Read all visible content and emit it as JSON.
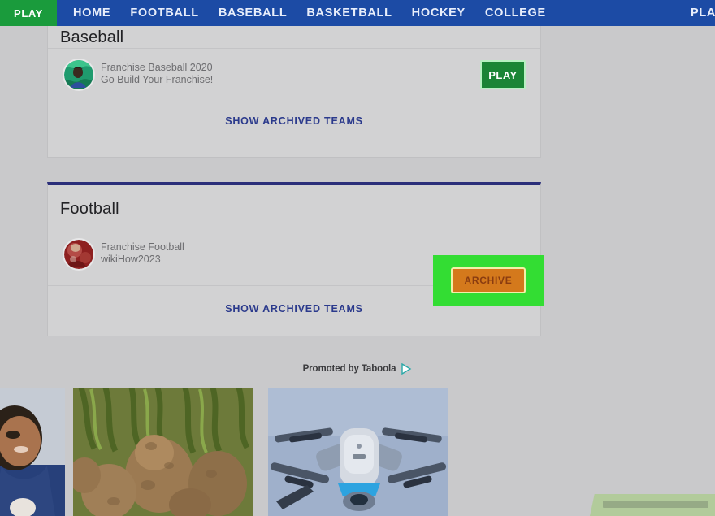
{
  "nav": {
    "play_tab_label": "PLAY",
    "links": [
      {
        "label": "HOME"
      },
      {
        "label": "FOOTBALL"
      },
      {
        "label": "BASEBALL"
      },
      {
        "label": "BASKETBALL"
      },
      {
        "label": "HOCKEY"
      },
      {
        "label": "COLLEGE"
      }
    ],
    "right_partial_label": "PLAY",
    "bar_color": "#1c4ba5",
    "play_tab_color": "#1a9b3c"
  },
  "sections": {
    "baseball": {
      "heading": "Baseball",
      "team": {
        "name": "Franchise Baseball 2020",
        "subtitle": "Go Build Your Franchise!",
        "action_label": "PLAY",
        "action_color": "#1a8535",
        "avatar_name": "baseball-team-avatar"
      },
      "archived_link_label": "SHOW ARCHIVED TEAMS"
    },
    "football": {
      "heading": "Football",
      "team": {
        "name": "Franchise Football",
        "subtitle": "wikiHow2023",
        "action_label": "ARCHIVE",
        "action_color": "#d4791c",
        "avatar_name": "football-team-avatar"
      },
      "archived_link_label": "SHOW ARCHIVED TEAMS",
      "highlight_color": "#33dd33"
    }
  },
  "ads": {
    "credit_label": "Promoted by Taboola",
    "icon_name": "taboola-play-icon",
    "items": [
      {
        "name": "ad-thumbnail-nurse"
      },
      {
        "name": "ad-thumbnail-root-vegetables"
      },
      {
        "name": "ad-thumbnail-drone"
      }
    ]
  }
}
